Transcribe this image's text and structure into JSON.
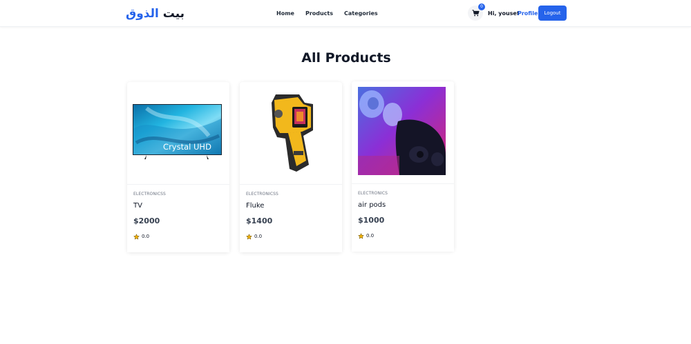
{
  "header": {
    "logo_word1": "بيت",
    "logo_word2": "الذوق",
    "nav": [
      "Home",
      "Products",
      "Categories"
    ],
    "cart_count": "0",
    "greeting": "Hi, yousef",
    "profile_label": "Profile",
    "logout_label": "Logout"
  },
  "main": {
    "title": "All Products",
    "products": [
      {
        "category": "ELECTRONICSS",
        "name": "TV",
        "price": "$2000",
        "rating": "0.0",
        "image": "tv-image"
      },
      {
        "category": "ELECTRONICSS",
        "name": "Fluke",
        "price": "$1400",
        "rating": "0.0",
        "image": "thermal-camera-image"
      },
      {
        "category": "ELECTRONICS",
        "name": "air pods",
        "price": "$1000",
        "rating": "0.0",
        "image": "earbuds-image"
      }
    ]
  },
  "tv_image_text": "Crystal UHD",
  "colors": {
    "accent": "#2563eb",
    "star": "#f5b301"
  }
}
